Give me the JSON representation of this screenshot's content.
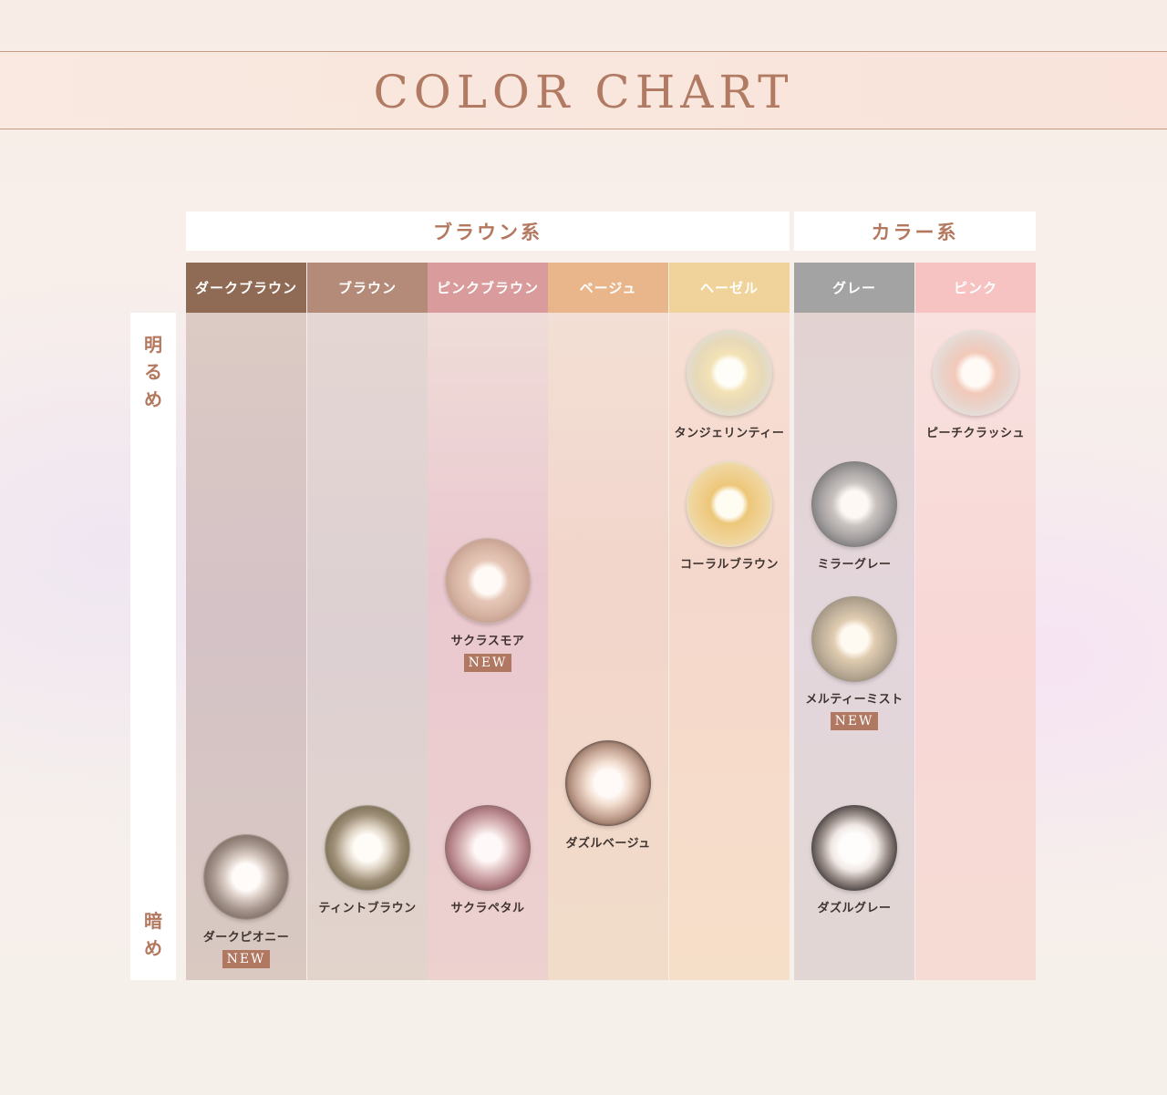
{
  "title": "COLOR CHART",
  "groups": {
    "brown": "ブラウン系",
    "color": "カラー系"
  },
  "axis": {
    "light": "明るめ",
    "dark": "暗め"
  },
  "columns": [
    {
      "label": "ダークブラウン",
      "color": "#8f6a55"
    },
    {
      "label": "ブラウン",
      "color": "#b48b78"
    },
    {
      "label": "ピンクブラウン",
      "color": "#d99b9b"
    },
    {
      "label": "ベージュ",
      "color": "#e8b68a"
    },
    {
      "label": "ヘーゼル",
      "color": "#f0d39a"
    },
    {
      "label": "グレー",
      "color": "#a3a3a3"
    },
    {
      "label": "ピンク",
      "color": "#f7c2c2"
    }
  ],
  "badge": "NEW",
  "lenses": [
    {
      "name": "タンジェリンティー",
      "column": "ヘーゼル",
      "is_new": false,
      "colors": {
        "inner": "#f3e2b6",
        "outer": "#e2dccf",
        "ring": "#c9c9c9"
      }
    },
    {
      "name": "ピーチクラッシュ",
      "column": "ピンク",
      "is_new": false,
      "colors": {
        "inner": "#f2c9b9",
        "outer": "#e6ddd9",
        "ring": "#cfcfcf"
      }
    },
    {
      "name": "コーラルブラウン",
      "column": "ヘーゼル",
      "is_new": false,
      "colors": {
        "inner": "#ecc77a",
        "outer": "#efd7a2",
        "ring": "#e2e2e2"
      }
    },
    {
      "name": "ミラーグレー",
      "column": "グレー",
      "is_new": false,
      "colors": {
        "inner": "#c9c2bf",
        "outer": "#8a8788",
        "ring": "#6f6c6d"
      }
    },
    {
      "name": "サクラスモア",
      "column": "ピンクブラウン",
      "is_new": true,
      "colors": {
        "inner": "#e6c7b7",
        "outer": "#caa494",
        "ring": "#cfcfcf"
      }
    },
    {
      "name": "メルティーミスト",
      "column": "グレー",
      "is_new": true,
      "colors": {
        "inner": "#e0ccb0",
        "outer": "#a99b87",
        "ring": "#9a9590"
      }
    },
    {
      "name": "ダズルベージュ",
      "column": "ベージュ",
      "is_new": false,
      "colors": {
        "inner": "#f1dcce",
        "outer": "#a78575",
        "ring": "#5e4e49"
      }
    },
    {
      "name": "ダークピオニー",
      "column": "ダークブラウン",
      "is_new": true,
      "colors": {
        "inner": "#e0d3cc",
        "outer": "#8a786f",
        "ring": "#cfcfcf"
      }
    },
    {
      "name": "ティントブラウン",
      "column": "ブラウン",
      "is_new": false,
      "colors": {
        "inner": "#dfd4c5",
        "outer": "#86785f",
        "ring": "#d6d6d6"
      }
    },
    {
      "name": "サクラペタル",
      "column": "ピンクブラウン",
      "is_new": false,
      "colors": {
        "inner": "#ead2d2",
        "outer": "#a8767b",
        "ring": "#8d6b6d"
      }
    },
    {
      "name": "ダズルグレー",
      "column": "グレー",
      "is_new": false,
      "colors": {
        "inner": "#efe7e4",
        "outer": "#6a615e",
        "ring": "#4a4443"
      }
    }
  ]
}
